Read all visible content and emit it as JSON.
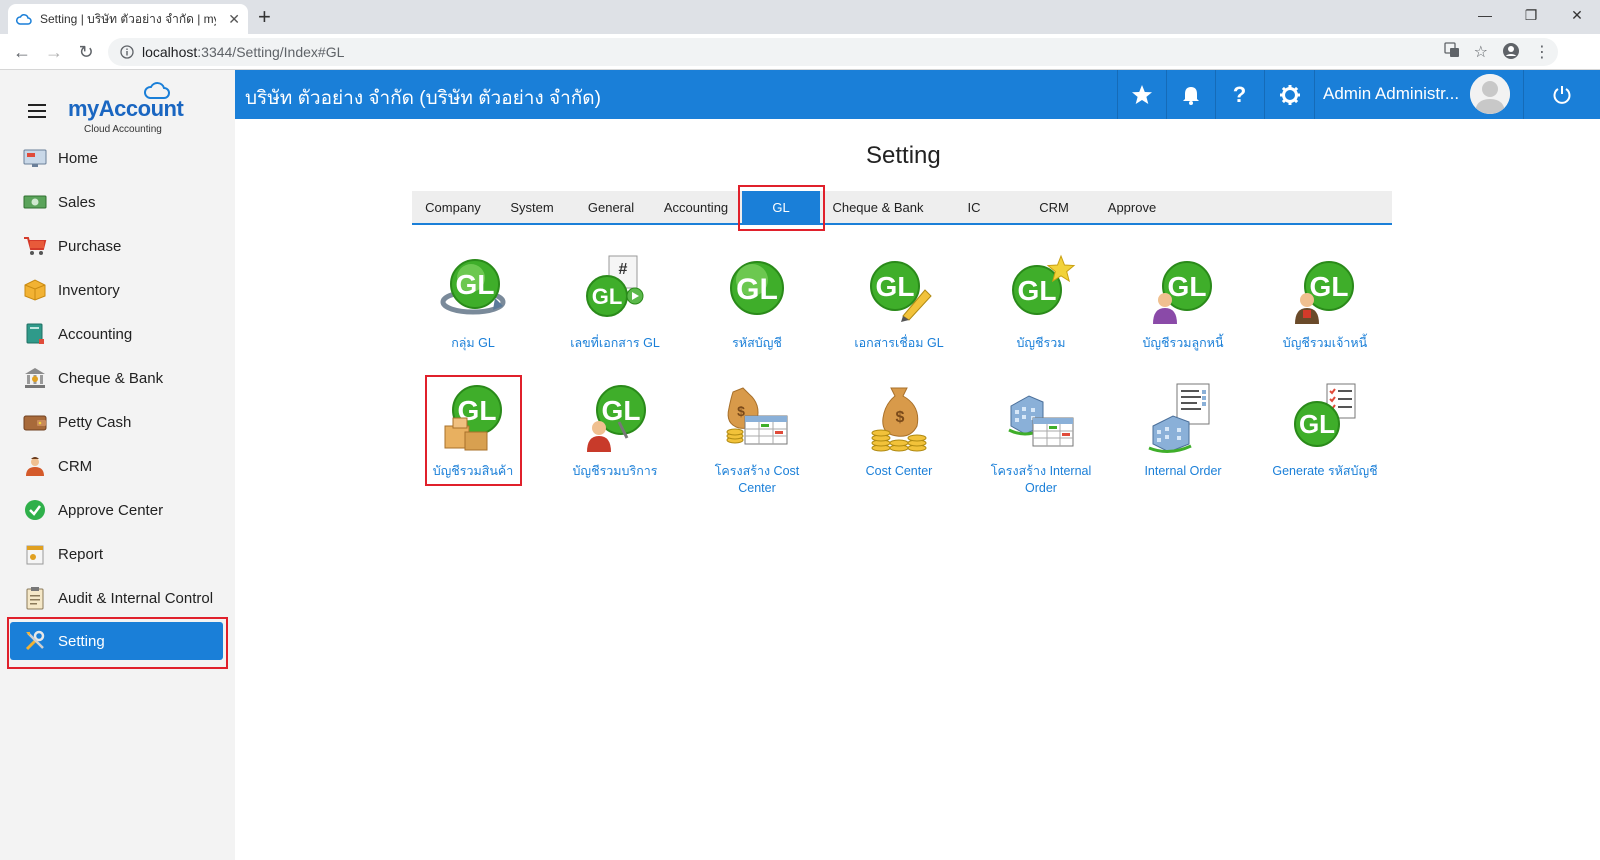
{
  "browser": {
    "tab_title": "Setting | บริษัท ตัวอย่าง จำกัด | myA",
    "url_host": "localhost",
    "url_rest": ":3344/Setting/Index#GL"
  },
  "sidebar": {
    "logo_my": "my",
    "logo_account": "Account",
    "logo_sub": "Cloud Accounting",
    "items": [
      {
        "label": "Home",
        "icon": "home-icon"
      },
      {
        "label": "Sales",
        "icon": "cash-icon"
      },
      {
        "label": "Purchase",
        "icon": "cart-icon"
      },
      {
        "label": "Inventory",
        "icon": "box-icon"
      },
      {
        "label": "Accounting",
        "icon": "book-icon"
      },
      {
        "label": "Cheque & Bank",
        "icon": "bank-icon"
      },
      {
        "label": "Petty Cash",
        "icon": "wallet-icon"
      },
      {
        "label": "CRM",
        "icon": "people-icon"
      },
      {
        "label": "Approve Center",
        "icon": "check-icon"
      },
      {
        "label": "Report",
        "icon": "report-icon"
      },
      {
        "label": "Audit & Internal Control",
        "icon": "clipboard-icon"
      },
      {
        "label": "Setting",
        "icon": "tools-icon"
      }
    ]
  },
  "header": {
    "company": "บริษัท ตัวอย่าง จำกัด (บริษัท ตัวอย่าง จำกัด)",
    "user": "Admin Administr..."
  },
  "main": {
    "title": "Setting",
    "tabs": [
      "Company",
      "System",
      "General",
      "Accounting",
      "GL",
      "Cheque & Bank",
      "IC",
      "CRM",
      "Approve"
    ],
    "active_tab": "GL",
    "row1": [
      "กลุ่ม GL",
      "เลขที่เอกสาร GL",
      "รหัสบัญชี",
      "เอกสารเชื่อม GL",
      "บัญชีรวม",
      "บัญชีรวมลูกหนี้",
      "บัญชีรวมเจ้าหนี้"
    ],
    "row2": [
      [
        "บัญชีรวมสินค้า"
      ],
      [
        "บัญชีรวมบริการ"
      ],
      [
        "โครงสร้าง Cost",
        "Center"
      ],
      [
        "Cost Center"
      ],
      [
        "โครงสร้าง Internal",
        "Order"
      ],
      [
        "Internal Order"
      ],
      [
        "Generate รหัสบัญชี"
      ]
    ]
  },
  "colors": {
    "brand_blue": "#1a7fd8",
    "highlight_red": "#e0202b",
    "gl_green": "#3fae2a"
  }
}
